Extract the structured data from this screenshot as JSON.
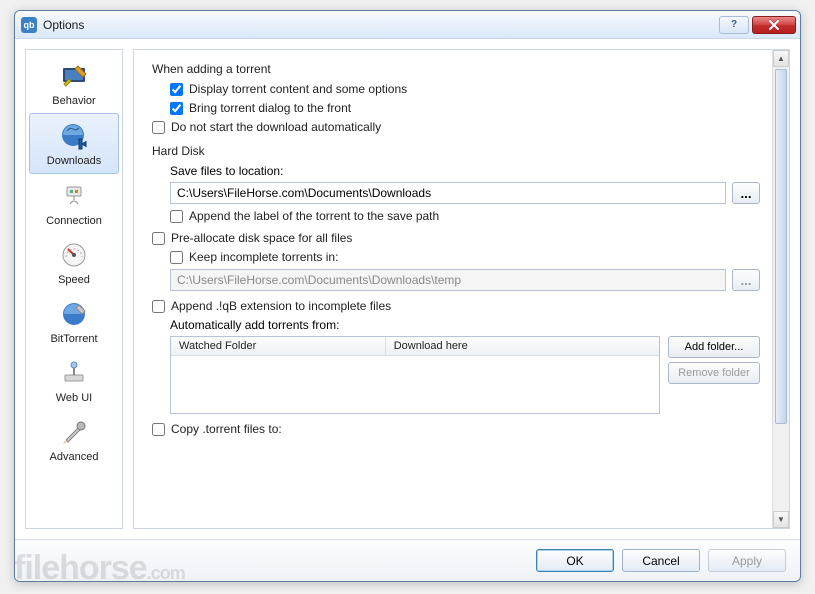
{
  "window": {
    "title": "Options",
    "app_glyph": "qb"
  },
  "sidebar": {
    "items": [
      {
        "label": "Behavior",
        "icon": "behavior-icon"
      },
      {
        "label": "Downloads",
        "icon": "downloads-icon",
        "selected": true
      },
      {
        "label": "Connection",
        "icon": "connection-icon"
      },
      {
        "label": "Speed",
        "icon": "speed-icon"
      },
      {
        "label": "BitTorrent",
        "icon": "bittorrent-icon"
      },
      {
        "label": "Web UI",
        "icon": "webui-icon"
      },
      {
        "label": "Advanced",
        "icon": "advanced-icon"
      }
    ]
  },
  "main": {
    "adding_group": "When adding a torrent",
    "display_content": {
      "label": "Display torrent content and some options",
      "checked": true
    },
    "bring_front": {
      "label": "Bring torrent dialog to the front",
      "checked": true
    },
    "no_autostart": {
      "label": "Do not start the download automatically",
      "checked": false
    },
    "hard_disk_group": "Hard Disk",
    "save_loc_label": "Save files to location:",
    "save_loc_path": "C:\\Users\\FileHorse.com\\Documents\\Downloads",
    "browse_glyph": "...",
    "append_label": {
      "label": "Append the label of the torrent to the save path",
      "checked": false
    },
    "prealloc": {
      "label": "Pre-allocate disk space for all files",
      "checked": false
    },
    "keep_incomplete": {
      "label": "Keep incomplete torrents in:",
      "checked": false
    },
    "incomplete_path": "C:\\Users\\FileHorse.com\\Documents\\Downloads\\temp",
    "append_qb": {
      "label": "Append .!qB extension to incomplete files",
      "checked": false
    },
    "auto_add_label": "Automatically add torrents from:",
    "table": {
      "col1": "Watched Folder",
      "col2": "Download here",
      "add_btn": "Add folder...",
      "remove_btn": "Remove folder"
    },
    "copy_torrent": {
      "label": "Copy .torrent files to:",
      "checked": false
    }
  },
  "footer": {
    "ok": "OK",
    "cancel": "Cancel",
    "apply": "Apply"
  },
  "watermark": {
    "main": "filehorse",
    "suffix": ".com"
  }
}
